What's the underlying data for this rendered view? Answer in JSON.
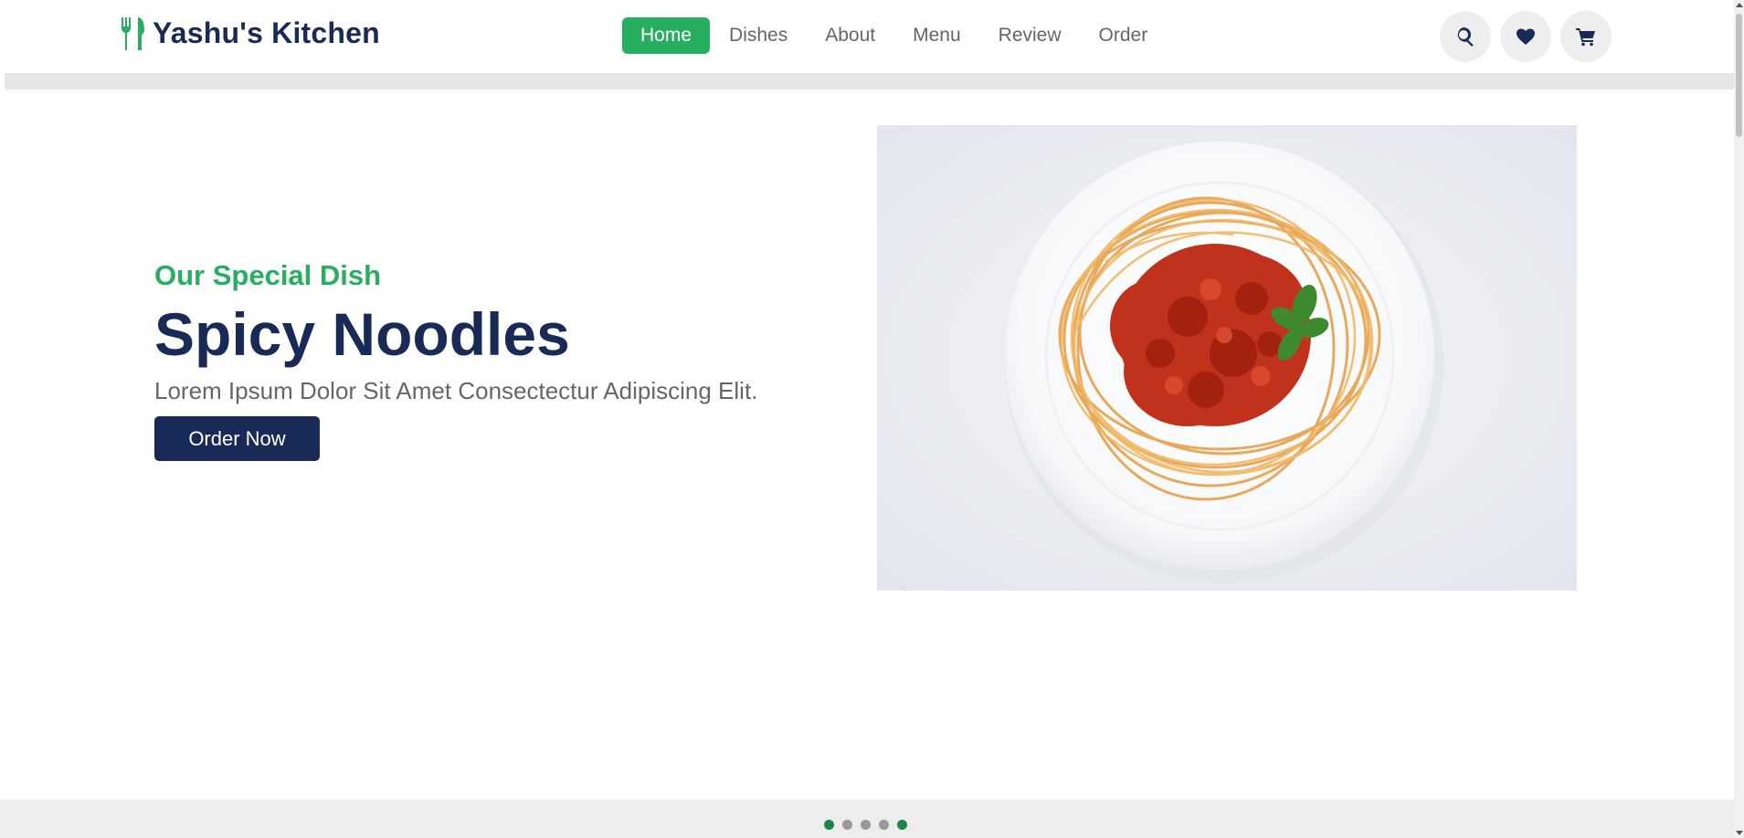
{
  "brand": {
    "name": "Yashu's Kitchen",
    "icon": "utensils-icon",
    "color": "#27ae60"
  },
  "nav": {
    "items": [
      {
        "label": "Home",
        "active": true
      },
      {
        "label": "Dishes",
        "active": false
      },
      {
        "label": "About",
        "active": false
      },
      {
        "label": "Menu",
        "active": false
      },
      {
        "label": "Review",
        "active": false
      },
      {
        "label": "Order",
        "active": false
      }
    ]
  },
  "actions": [
    {
      "icon": "search-icon"
    },
    {
      "icon": "heart-icon"
    },
    {
      "icon": "shopping-cart-icon"
    }
  ],
  "hero": {
    "subtitle": "Our Special Dish",
    "title": "Spicy Noodles",
    "description": "Lorem Ipsum Dolor Sit Amet Consectectur Adipiscing Elit.",
    "button_label": "Order Now",
    "image": "spaghetti-plate-image"
  },
  "slider": {
    "count": 5,
    "active_index": 0,
    "active_indices": [
      0,
      4
    ]
  },
  "colors": {
    "accent": "#27ae60",
    "primary": "#192a56",
    "text": "#666666"
  }
}
